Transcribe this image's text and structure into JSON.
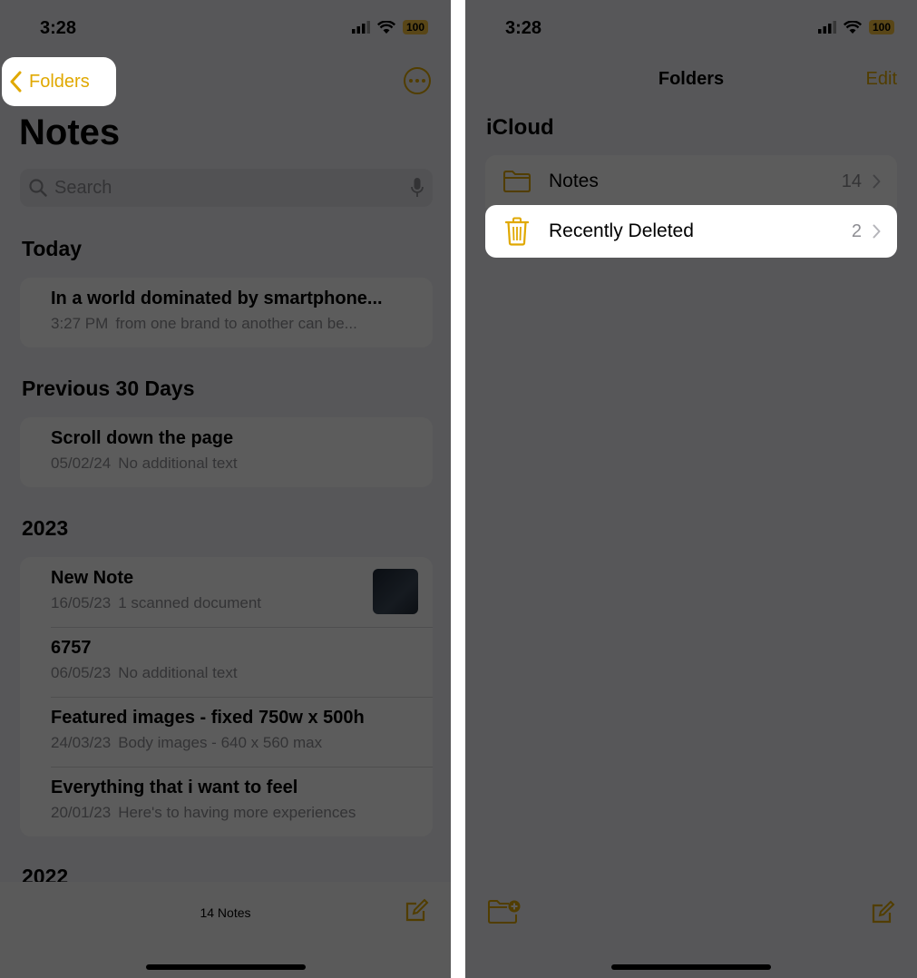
{
  "left": {
    "status": {
      "time": "3:28",
      "battery": "100"
    },
    "back_label": "Folders",
    "title": "Notes",
    "search_placeholder": "Search",
    "sections": {
      "today": "Today",
      "prev30": "Previous 30 Days",
      "y2023": "2023",
      "y2022": "2022"
    },
    "notes_today": [
      {
        "title": "In a world dominated by smartphone...",
        "date": "3:27 PM",
        "preview": "from one brand to another can be..."
      }
    ],
    "notes_prev30": [
      {
        "title": "Scroll down the page",
        "date": "05/02/24",
        "preview": "No additional text"
      }
    ],
    "notes_2023": [
      {
        "title": "New Note",
        "date": "16/05/23",
        "preview": "1 scanned document"
      },
      {
        "title": "6757",
        "date": "06/05/23",
        "preview": "No additional text"
      },
      {
        "title": "Featured images - fixed 750w x 500h",
        "date": "24/03/23",
        "preview": "Body images - 640 x 560 max"
      },
      {
        "title": "Everything that i want to feel",
        "date": "20/01/23",
        "preview": "Here's to having more experiences"
      }
    ],
    "notes_count": "14 Notes"
  },
  "right": {
    "status": {
      "time": "3:28",
      "battery": "100"
    },
    "nav_title": "Folders",
    "edit_label": "Edit",
    "group": "iCloud",
    "folders": [
      {
        "name": "Notes",
        "count": "14"
      },
      {
        "name": "Recently Deleted",
        "count": "2"
      }
    ]
  },
  "colors": {
    "accent": "#e0a800",
    "battery": "#f6c342",
    "dim_overlay": "rgba(0,0,0,0.64)"
  }
}
